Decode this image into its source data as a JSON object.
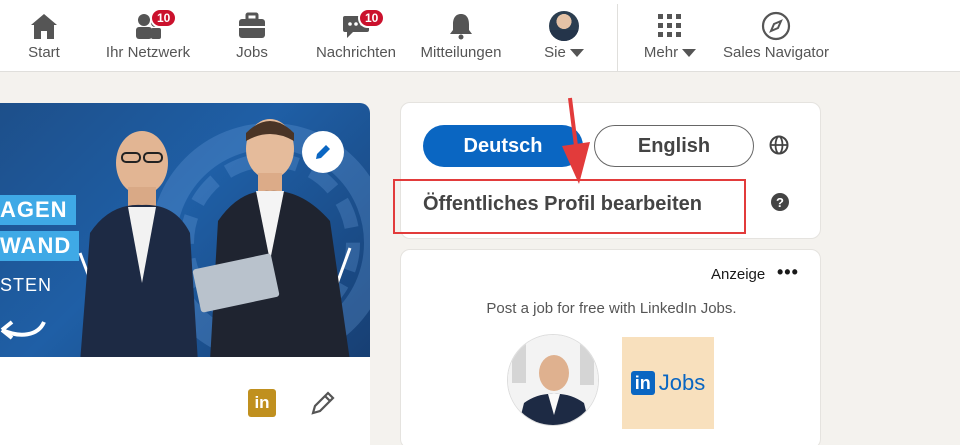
{
  "nav": {
    "items": [
      {
        "label": "Start",
        "icon": "home-icon"
      },
      {
        "label": "Ihr Netzwerk",
        "icon": "network-icon",
        "badge": "10"
      },
      {
        "label": "Jobs",
        "icon": "briefcase-icon"
      },
      {
        "label": "Nachrichten",
        "icon": "messages-icon",
        "badge": "10"
      },
      {
        "label": "Mitteilungen",
        "icon": "bell-icon"
      },
      {
        "label": "Sie",
        "icon": "avatar"
      },
      {
        "label": "Mehr",
        "icon": "grid-icon"
      },
      {
        "label": "Sales Navigator",
        "icon": "compass-icon"
      }
    ]
  },
  "banner": {
    "tag1": "AGEN",
    "tag2": "WAND",
    "tag3": "STEN"
  },
  "profile": {
    "badge_text": "in"
  },
  "language": {
    "active": "Deutsch",
    "other": "English",
    "edit_link": "Öffentliches Profil bearbeiten",
    "help": "?"
  },
  "ad": {
    "label": "Anzeige",
    "menu": "•••",
    "text": "Post a job for free with LinkedIn Jobs.",
    "logo_in": "in",
    "logo_jobs": "Jobs"
  },
  "colors": {
    "brand": "#0a66c2",
    "badge": "#cb112d",
    "annotation": "#e23b3b"
  }
}
